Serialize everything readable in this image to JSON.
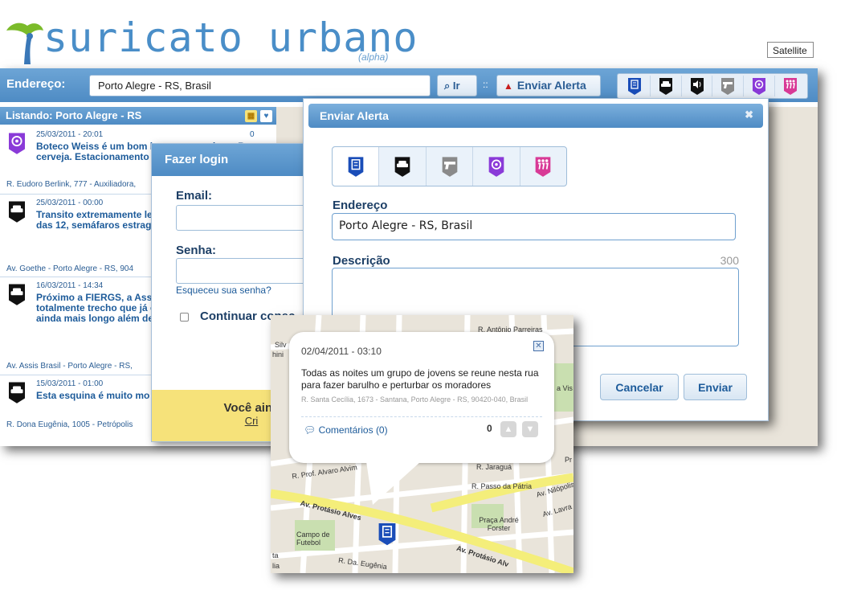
{
  "brand": {
    "name": "suricato urbano",
    "tag": "(alpha)"
  },
  "topbar": {
    "address_label": "Endereço:",
    "address_value": "Porto Alegre - RS, Brasil",
    "go_label": "Ir",
    "separator": "::",
    "alert_label": "Enviar Alerta",
    "satellite_label": "Satellite"
  },
  "listing": {
    "header": "Listando: Porto Alegre - RS",
    "items": [
      {
        "date": "25/03/2011 - 20:01",
        "title": "Boteco Weiss é um bom lugar com amigos. Boa cerveja. Estacionamento em frente",
        "address": "R. Eudoro Berlink, 777 - Auxiliadora,",
        "count": "0"
      },
      {
        "date": "25/03/2011 - 00:00",
        "title": "Transito extremamente lento na avenida, por volta das 12, semáfaros estragados. Ipiranga.",
        "address": "Av. Goethe - Porto Alegre - RS, 904"
      },
      {
        "date": "16/03/2011 - 14:34",
        "title": "Próximo a FIERGS, a Assis seus semáforos totalmente trecho que já é longo para torna-se ainda mais longo além de ser entediante p",
        "address": "Av. Assis Brasil - Porto Alegre - RS,"
      },
      {
        "date": "15/03/2011 - 01:00",
        "title": "Esta esquina é muito mo semáforo.",
        "address": "R. Dona Eugênia, 1005 - Petrópolis"
      }
    ]
  },
  "login": {
    "title": "Fazer login",
    "email_label": "Email:",
    "password_label": "Senha:",
    "forgot": "Esqueceu sua senha?",
    "remember": "Continuar conec",
    "banner": "Você ainc",
    "banner_link": "Cri"
  },
  "alert_dialog": {
    "title": "Enviar Alerta",
    "address_label": "Endereço",
    "address_value": "Porto Alegre - RS, Brasil",
    "description_label": "Descrição",
    "char_limit": "300",
    "cancel": "Cancelar",
    "send": "Enviar"
  },
  "popup": {
    "date": "02/04/2011 - 03:10",
    "text": "Todas as noites um grupo de jovens se reune nesta rua para fazer barulho e perturbar os moradores",
    "address": "R. Santa Cecília, 1673 - Santana, Porto Alegre - RS, 90420-040, Brasil",
    "comments": "Comentários (0)",
    "votes": "0"
  },
  "map_labels": {
    "prof_alvaro": "R. Prof. Alvaro Alvim",
    "protasio": "Av. Protásio Alves",
    "protasio2": "Av. Protásio Alv",
    "passo_patria": "R. Passo da Pátria",
    "jaragua": "R. Jaraguá",
    "praca": "Praça André Forster",
    "campo": "Campo de Futebol",
    "eugenia": "R. Da. Eugênia",
    "antonio": "R. Antônio Parreiras",
    "nilopolis": "Av. Nilópolis",
    "lavra": "Av. Lavra",
    "vis": "a Vis",
    "silv": "Silv",
    "hini": "hini",
    "ta": "ta",
    "lia": "lia",
    "pr": "Pr"
  },
  "colors": {
    "header_blue": "#4e8bc4",
    "alert_red": "#c81e1e",
    "banner_yellow": "#f6e27a",
    "pin_blue": "#1a4db8",
    "pin_purple": "#8a3ad8",
    "pin_pink": "#d83a96"
  },
  "icons": [
    "note-icon",
    "car-icon",
    "sound-icon",
    "gun-icon",
    "food-icon",
    "people-icon"
  ]
}
